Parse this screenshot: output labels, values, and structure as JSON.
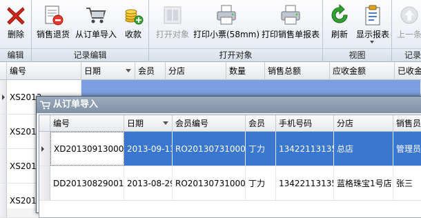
{
  "ribbon": {
    "groups": [
      {
        "title": "编辑",
        "buttons": [
          {
            "label": "删除",
            "icon": "delete-icon"
          }
        ]
      },
      {
        "title": "记录编辑",
        "buttons": [
          {
            "label": "销售退货",
            "icon": "sales-return-icon"
          },
          {
            "label": "从订单导入",
            "icon": "cart-import-icon"
          },
          {
            "label": "收款",
            "icon": "coins-icon"
          }
        ]
      },
      {
        "title": "打开对象",
        "buttons": [
          {
            "label": "打开对象",
            "icon": "open-object-icon",
            "disabled": true
          },
          {
            "label": "打印小票(58mm)",
            "icon": "printer-icon"
          },
          {
            "label": "打印销售单报表",
            "icon": "printer-icon"
          }
        ]
      },
      {
        "title": "视图",
        "buttons": [
          {
            "label": "刷新",
            "icon": "refresh-icon"
          },
          {
            "label": "显示报表",
            "icon": "report-icon"
          }
        ]
      },
      {
        "title": "记录",
        "buttons": [
          {
            "label": "上一条",
            "icon": "up-arrow-icon",
            "disabled": true
          }
        ]
      }
    ]
  },
  "main_grid": {
    "columns": [
      "编号",
      "日期",
      "会员",
      "分店",
      "数量",
      "销售总额",
      "应收金额",
      "已收金"
    ],
    "rows": [
      "XS2013",
      "XS2013",
      "XS2013",
      "XS2013"
    ]
  },
  "dialog": {
    "title": "从订单导入",
    "columns": [
      "编号",
      "日期",
      "会员编号",
      "会员",
      "手机号码",
      "分店",
      "销售员"
    ],
    "rows": [
      [
        "XD201309130001",
        "2013-09-13",
        "RO201307310001",
        "丁力",
        "13422113135",
        "总店",
        "管理员"
      ],
      [
        "DD201308290015",
        "2013-08-29",
        "RO201307310001",
        "丁力",
        "13422113135",
        "蓝格珠宝1号店",
        "张三"
      ]
    ]
  },
  "colors": {
    "selection": "#3a77d1",
    "main_selection": "#7b9fe0",
    "dialog_title": "#8a9bb0"
  }
}
